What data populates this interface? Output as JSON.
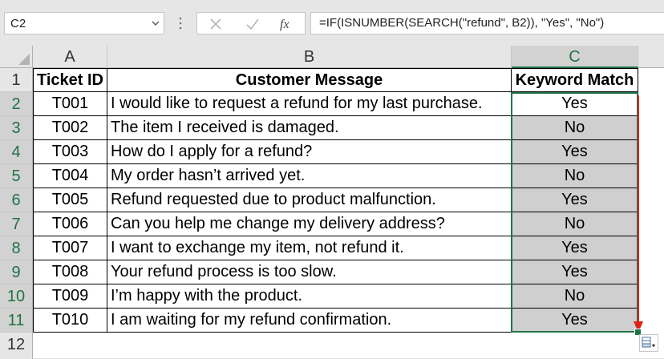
{
  "name_box": {
    "value": "C2"
  },
  "formula_bar": {
    "formula": "=IF(ISNUMBER(SEARCH(\"refund\", B2)), \"Yes\", \"No\")",
    "cancel_icon": "x-icon",
    "enter_icon": "check-icon",
    "function_icon": "fx-icon"
  },
  "columns": [
    "A",
    "B",
    "C"
  ],
  "rows": [
    "1",
    "2",
    "3",
    "4",
    "5",
    "6",
    "7",
    "8",
    "9",
    "10",
    "11",
    "12"
  ],
  "table": {
    "headers": [
      "Ticket ID",
      "Customer Message",
      "Keyword Match"
    ],
    "data": [
      {
        "id": "T001",
        "message": "I would like to request a refund for my last purchase.",
        "match": "Yes"
      },
      {
        "id": "T002",
        "message": "The item I received is damaged.",
        "match": "No"
      },
      {
        "id": "T003",
        "message": "How do I apply for a refund?",
        "match": "Yes"
      },
      {
        "id": "T004",
        "message": "My order hasn’t arrived yet.",
        "match": "No"
      },
      {
        "id": "T005",
        "message": "Refund requested due to product malfunction.",
        "match": "Yes"
      },
      {
        "id": "T006",
        "message": "Can you help me change my delivery address?",
        "match": "No"
      },
      {
        "id": "T007",
        "message": "I want to exchange my item, not refund it.",
        "match": "Yes"
      },
      {
        "id": "T008",
        "message": "Your refund process is too slow.",
        "match": "Yes"
      },
      {
        "id": "T009",
        "message": "I’m happy with the product.",
        "match": "No"
      },
      {
        "id": "T010",
        "message": "I am waiting for my refund confirmation.",
        "match": "Yes"
      }
    ]
  },
  "colors": {
    "accent": "#217346",
    "arrow": "#e0201a",
    "selection_fill": "#cfcfcf"
  }
}
